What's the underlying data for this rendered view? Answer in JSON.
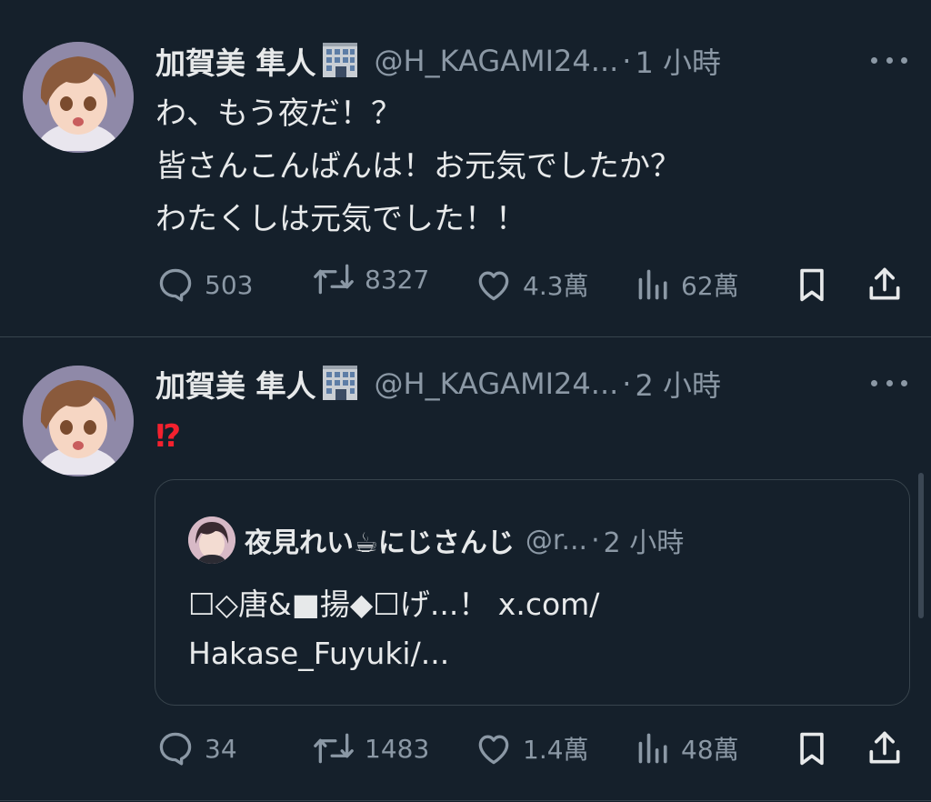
{
  "tweets": [
    {
      "display_name": "加賀美 隼人",
      "name_emoji": "office-building-emoji",
      "handle": "@H_KAGAMI24...",
      "separator": "·",
      "time": "1 小時",
      "text": "わ、もう夜だ！？\n皆さんこんばんは！お元気でしたか？\nわたくしは元気でした！！",
      "stats": {
        "replies": "503",
        "retweets": "8327",
        "likes": "4.3萬",
        "views": "62萬"
      }
    },
    {
      "display_name": "加賀美 隼人",
      "name_emoji": "office-building-emoji",
      "handle": "@H_KAGAMI24...",
      "separator": "·",
      "time": "2 小時",
      "text": "⁉",
      "quote": {
        "display_name": "夜見れい☕にじさんじ",
        "handle": "@r...",
        "separator": "·",
        "time": "2 小時",
        "text": "☐◇唐&■揚◆☐げ...！ x.com/\nHakase_Fuyuki/..."
      },
      "stats": {
        "replies": "34",
        "retweets": "1483",
        "likes": "1.4萬",
        "views": "48萬"
      }
    }
  ],
  "colors": {
    "background": "#15202b",
    "text_primary": "#e7e9ea",
    "text_secondary": "#8b98a5",
    "divider": "#38444d",
    "emphasis_red": "#f4212e"
  }
}
